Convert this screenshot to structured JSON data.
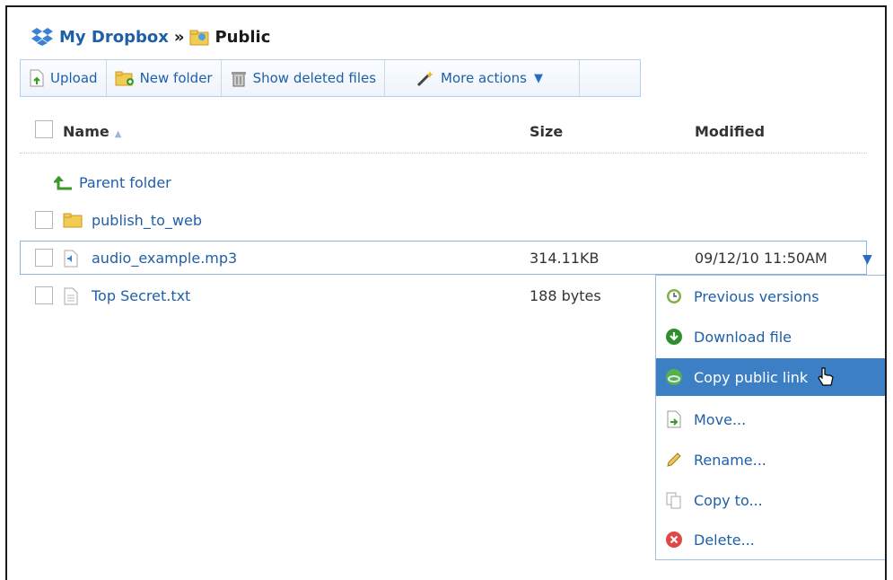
{
  "breadcrumb": {
    "root": "My Dropbox",
    "separator": "»",
    "current": "Public"
  },
  "toolbar": {
    "upload": "Upload",
    "new_folder": "New folder",
    "show_deleted": "Show deleted files",
    "more_actions": "More actions",
    "more_arrow": "▼"
  },
  "columns": {
    "name": "Name",
    "sort_indicator": "▲",
    "size": "Size",
    "modified": "Modified"
  },
  "rows": [
    {
      "label": "Parent folder",
      "icon": "parent-folder-arrow-icon",
      "size": "",
      "modified": ""
    },
    {
      "label": "publish_to_web",
      "icon": "folder-icon",
      "size": "",
      "modified": ""
    },
    {
      "label": "audio_example.mp3",
      "icon": "audio-file-icon",
      "size": "314.11KB",
      "modified": "09/12/10  11:50AM",
      "selected": true,
      "caret": "▼"
    },
    {
      "label": "Top Secret.txt",
      "icon": "text-file-icon",
      "size": "188 bytes",
      "modified": ""
    }
  ],
  "context_menu": {
    "items": [
      {
        "label": "Previous versions",
        "icon": "clock-icon"
      },
      {
        "label": "Download file",
        "icon": "download-icon"
      },
      {
        "label": "Copy public link",
        "icon": "link-globe-icon",
        "highlighted": true
      },
      {
        "label": "Move...",
        "icon": "move-icon"
      },
      {
        "label": "Rename...",
        "icon": "rename-pencil-icon"
      },
      {
        "label": "Copy to...",
        "icon": "copy-icon"
      },
      {
        "label": "Delete...",
        "icon": "delete-icon"
      }
    ]
  },
  "colors": {
    "link": "#1f5fa8",
    "highlight": "#3d7fc4",
    "border": "#9fbfe0"
  }
}
